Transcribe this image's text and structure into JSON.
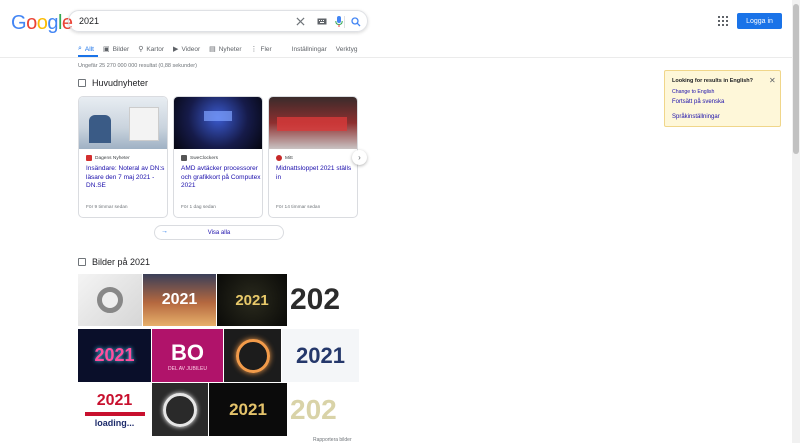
{
  "header": {
    "logo_letters": [
      "G",
      "o",
      "o",
      "g",
      "l",
      "e"
    ],
    "query": "2021",
    "login_label": "Logga in"
  },
  "tabs": [
    {
      "label": "Allt",
      "icon": "search-icon",
      "active": true
    },
    {
      "label": "Bilder",
      "icon": "image-icon"
    },
    {
      "label": "Kartor",
      "icon": "map-pin-icon"
    },
    {
      "label": "Videor",
      "icon": "video-icon"
    },
    {
      "label": "Nyheter",
      "icon": "news-icon"
    },
    {
      "label": "Fler",
      "icon": "more-icon"
    },
    {
      "label": "Inställningar"
    },
    {
      "label": "Verktyg"
    }
  ],
  "stats": "Ungefär 25 270 000 000 resultat (0,88 sekunder)",
  "news": {
    "title": "Huvudnyheter",
    "cards": [
      {
        "source": "Dagens Nyheter",
        "headline": "Insändare: Noteral av DN:s läsare den 7 maj 2021 - DN.SE",
        "age": "För 9 timmar sedan",
        "fav_color": "#d32f2f"
      },
      {
        "source": "SweClockers",
        "headline": "AMD avtäcker processorer och grafikkort på Computex 2021",
        "age": "För 1 dag sedan",
        "fav_color": "#555555"
      },
      {
        "source": "Mitt",
        "headline": "Midnattsloppet 2021 ställs in",
        "age": "För 14 timmar sedan",
        "fav_color": "#c62828"
      }
    ],
    "view_all": "Visa alla"
  },
  "images": {
    "title": "Bilder på 2021",
    "more": "Rapportera bilder",
    "tiles": [
      {
        "text": "",
        "alt": "roll-image"
      },
      {
        "text": "2021",
        "alt": "sunset-2021"
      },
      {
        "text": "2021",
        "alt": "gold-confetti-2021"
      },
      {
        "text": "202",
        "alt": "black-2021"
      },
      {
        "text": "2021",
        "alt": "neon-2021"
      },
      {
        "text": "BO",
        "alt": "bo-stad-2021"
      },
      {
        "text": "",
        "alt": "eclipse-ring"
      },
      {
        "text": "2021",
        "alt": "blue-2021"
      },
      {
        "text": "2021",
        "alt": "loading-2021"
      },
      {
        "text": "",
        "alt": "eclipse-ring-2"
      },
      {
        "text": "2021",
        "alt": "glow-2021"
      },
      {
        "text": "202",
        "alt": "pattern-2021"
      }
    ],
    "loading": "loading...",
    "bo_sub": "STAD",
    "bo_bottom": "DEL AV JUBILEU"
  },
  "language_box": {
    "title": "Looking for results in English?",
    "change": "Change to English",
    "continue": "Fortsätt på svenska",
    "settings": "Språkinställningar"
  },
  "colors": {
    "link": "#1a0dab",
    "accent": "#1a73e8"
  }
}
